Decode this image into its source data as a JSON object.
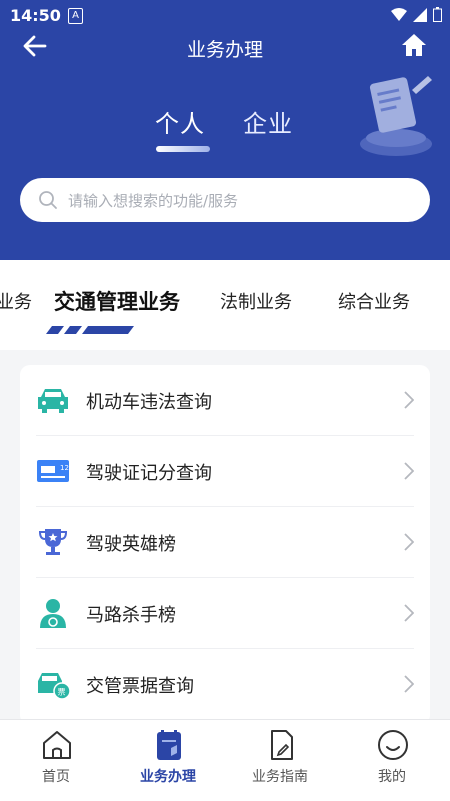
{
  "status_bar": {
    "time": "14:50",
    "notif_letter": "A"
  },
  "topbar": {
    "title": "业务办理"
  },
  "segments": [
    {
      "label": "个人"
    },
    {
      "label": "企业"
    }
  ],
  "search": {
    "placeholder": "请输入想搜索的功能/服务"
  },
  "categories": [
    {
      "label": "业务"
    },
    {
      "label": "交通管理业务"
    },
    {
      "label": "法制业务"
    },
    {
      "label": "综合业务"
    }
  ],
  "items": [
    {
      "label": "机动车违法查询",
      "icon": "car-icon"
    },
    {
      "label": "驾驶证记分查询",
      "icon": "license-card-icon"
    },
    {
      "label": "驾驶英雄榜",
      "icon": "trophy-icon"
    },
    {
      "label": "马路杀手榜",
      "icon": "driver-icon"
    },
    {
      "label": "交管票据查询",
      "icon": "car-ticket-icon"
    }
  ],
  "tabs": [
    {
      "label": "首页",
      "icon": "home-outline-icon"
    },
    {
      "label": "业务办理",
      "icon": "business-icon"
    },
    {
      "label": "业务指南",
      "icon": "guide-icon"
    },
    {
      "label": "我的",
      "icon": "smile-icon"
    }
  ],
  "colors": {
    "brand": "#2b45a6",
    "teal": "#2ab5a5",
    "blue": "#3b82f6"
  }
}
